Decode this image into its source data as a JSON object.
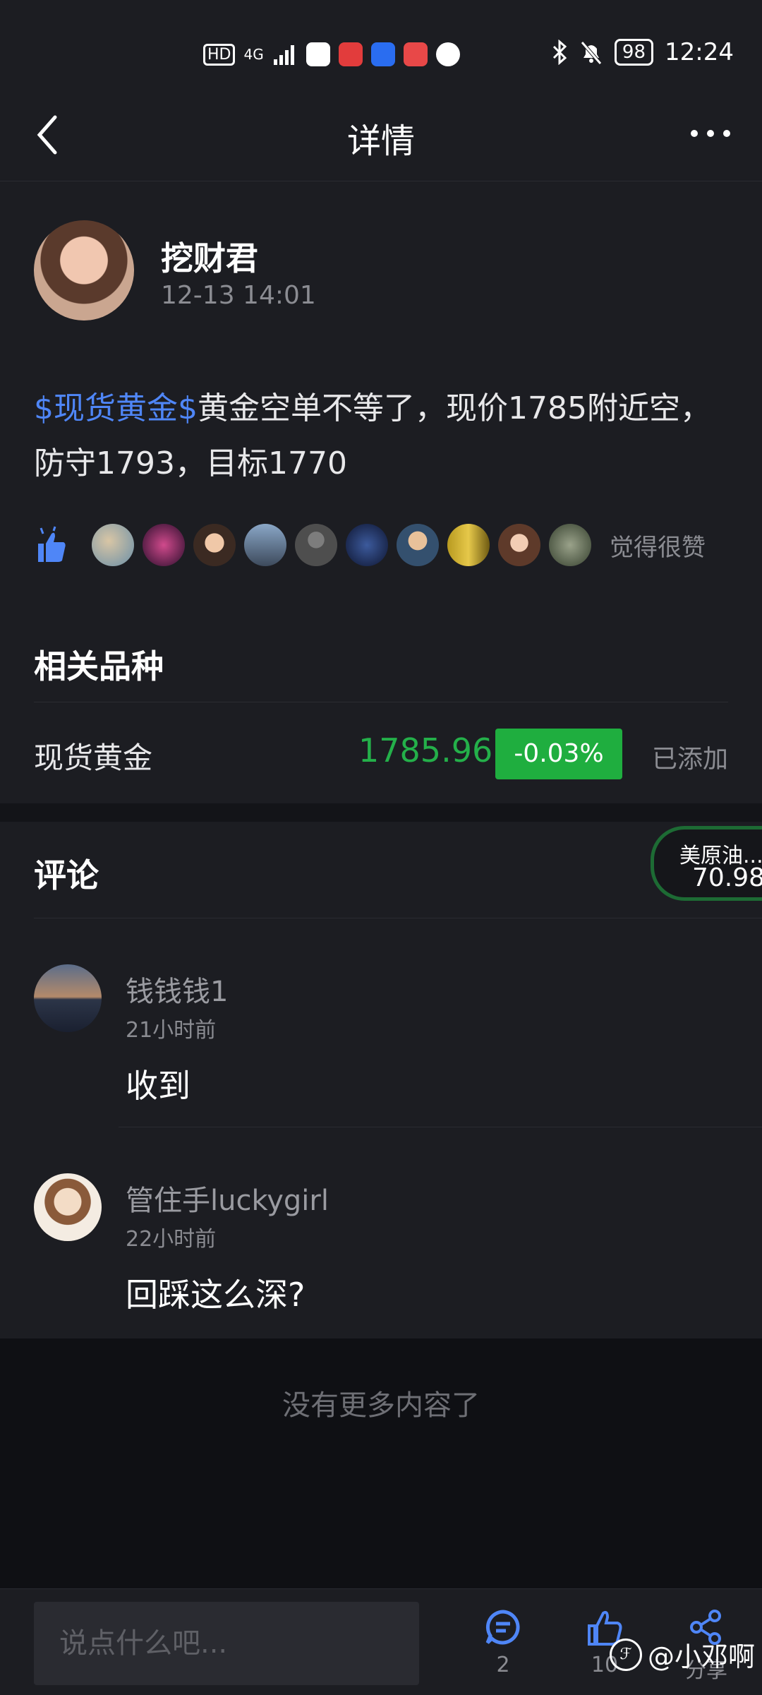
{
  "status_bar": {
    "time": "12:24",
    "battery": "98",
    "network": "4G",
    "hd": "HD"
  },
  "header": {
    "title": "详情"
  },
  "post": {
    "author": "挖财君",
    "time": "12-13 14:01",
    "tag": "$现货黄金$",
    "text": "黄金空单不等了，现价1785附近空，防守1793，目标1770",
    "likes_text": "觉得很赞"
  },
  "related": {
    "title": "相关品种",
    "name": "现货黄金",
    "price": "1785.96",
    "change": "-0.03%",
    "added": "已添加"
  },
  "comments_section": {
    "title": "评论",
    "floating": {
      "name": "美原油...",
      "value": "70.98"
    },
    "items": [
      {
        "user": "钱钱钱1",
        "time": "21小时前",
        "text": "收到"
      },
      {
        "user": "管住手luckygirl",
        "time": "22小时前",
        "text": "回踩这么深?"
      }
    ],
    "no_more": "没有更多内容了"
  },
  "bottom_bar": {
    "placeholder": "说点什么吧...",
    "comment_count": "2",
    "like_count": "10",
    "share_label": "分享"
  },
  "watermark": "@小邓啊",
  "colors": {
    "accent": "#4f86f7",
    "up_green": "#1fae3f",
    "background": "#1c1d22"
  }
}
